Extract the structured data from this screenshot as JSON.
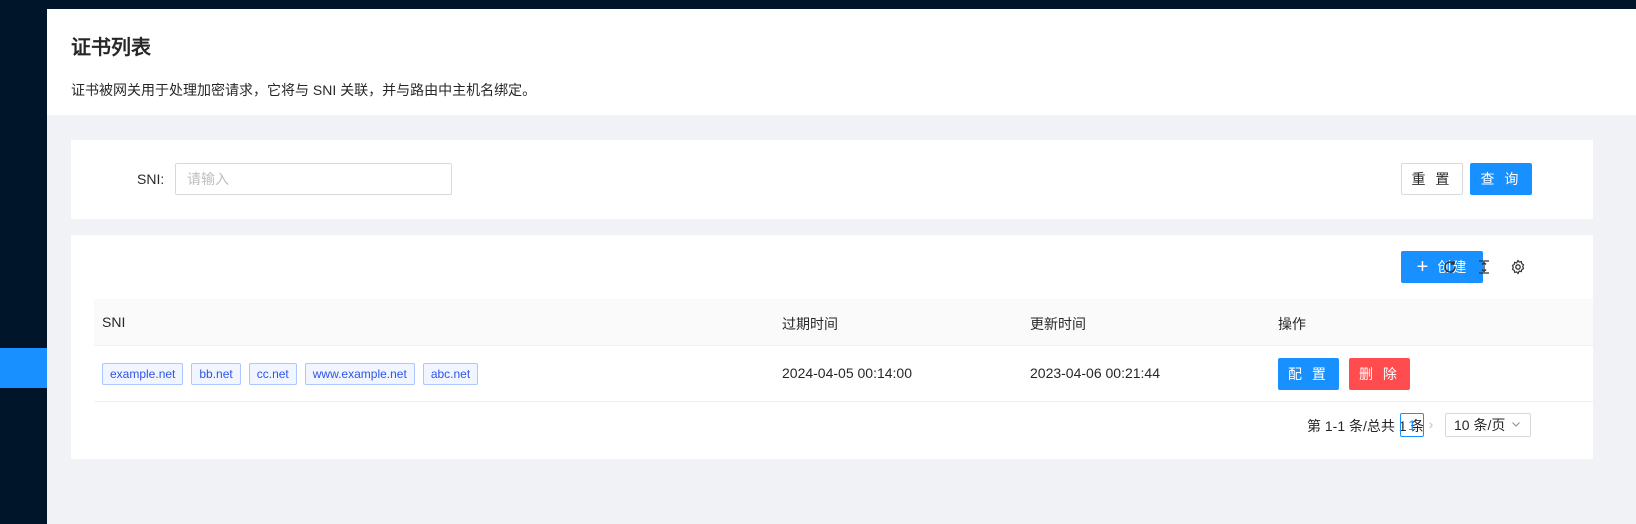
{
  "header": {
    "title": "证书列表",
    "description": "证书被网关用于处理加密请求，它将与 SNI 关联，并与路由中主机名绑定。"
  },
  "search": {
    "sni_label": "SNI:",
    "sni_placeholder": "请输入",
    "reset_label": "重 置",
    "query_label": "查 询"
  },
  "toolbar": {
    "create_label": "创建",
    "icons": [
      "reload-icon",
      "column-height-icon",
      "setting-icon"
    ]
  },
  "table": {
    "columns": [
      "SNI",
      "过期时间",
      "更新时间",
      "操作"
    ],
    "rows": [
      {
        "sni_tags": [
          "example.net",
          "bb.net",
          "cc.net",
          "www.example.net",
          "abc.net"
        ],
        "expire_time": "2024-04-05 00:14:00",
        "update_time": "2023-04-06 00:21:44",
        "actions": [
          "配 置",
          "删 除"
        ]
      }
    ]
  },
  "pagination": {
    "total_text": "第 1-1 条/总共 1 条",
    "current_page": "1",
    "page_size": "10 条/页"
  },
  "colors": {
    "primary": "#1890ff",
    "danger": "#ff4d4f",
    "sidebar": "#001529",
    "tag_text": "#2f54eb"
  }
}
